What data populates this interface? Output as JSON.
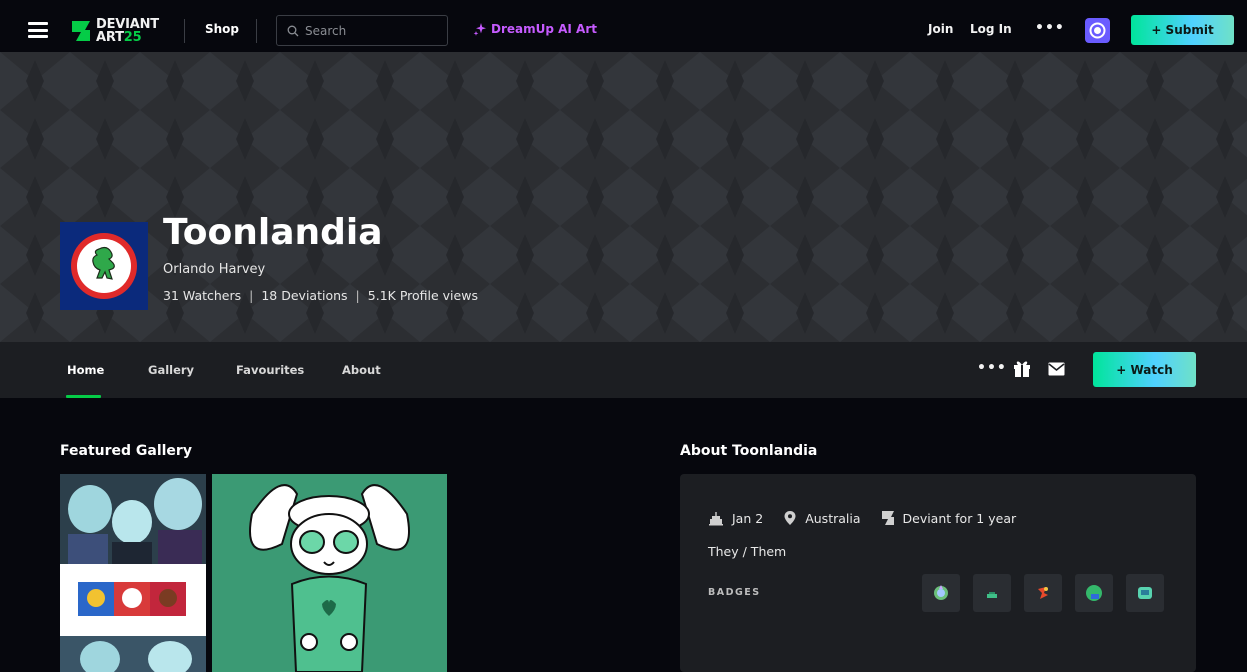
{
  "topbar": {
    "logo_line1": "DEVIANT",
    "logo_line2a": "ART",
    "logo_line2b": "25",
    "shop_label": "Shop",
    "search_placeholder": "Search",
    "dreamup_label": "DreamUp AI Art",
    "join_label": "Join",
    "login_label": "Log In",
    "more_label": "•••",
    "submit_label": "+ Submit"
  },
  "profile": {
    "name": "Toonlandia",
    "real_name": "Orlando Harvey",
    "stats": {
      "watchers": "31 Watchers",
      "deviations": "18 Deviations",
      "views": "5.1K Profile views",
      "separator": "|"
    }
  },
  "nav": {
    "tabs": [
      {
        "label": "Home",
        "active": true
      },
      {
        "label": "Gallery",
        "active": false
      },
      {
        "label": "Favourites",
        "active": false
      },
      {
        "label": "About",
        "active": false
      }
    ],
    "more_label": "•••",
    "watch_label": "+ Watch"
  },
  "featured": {
    "title": "Featured Gallery"
  },
  "about": {
    "title": "About Toonlandia",
    "birthday": "Jan 2",
    "location": "Australia",
    "deviant_for": "Deviant for 1 year",
    "pronouns": "They / Them",
    "badges_label": "BADGES",
    "badges": [
      "badge-icon-1",
      "badge-icon-2",
      "badge-icon-3",
      "badge-icon-4",
      "badge-icon-5"
    ]
  },
  "colors": {
    "accent_green": "#05cc47",
    "dreamup_purple": "#c65bff",
    "submit_gradient": "#00e59b"
  }
}
